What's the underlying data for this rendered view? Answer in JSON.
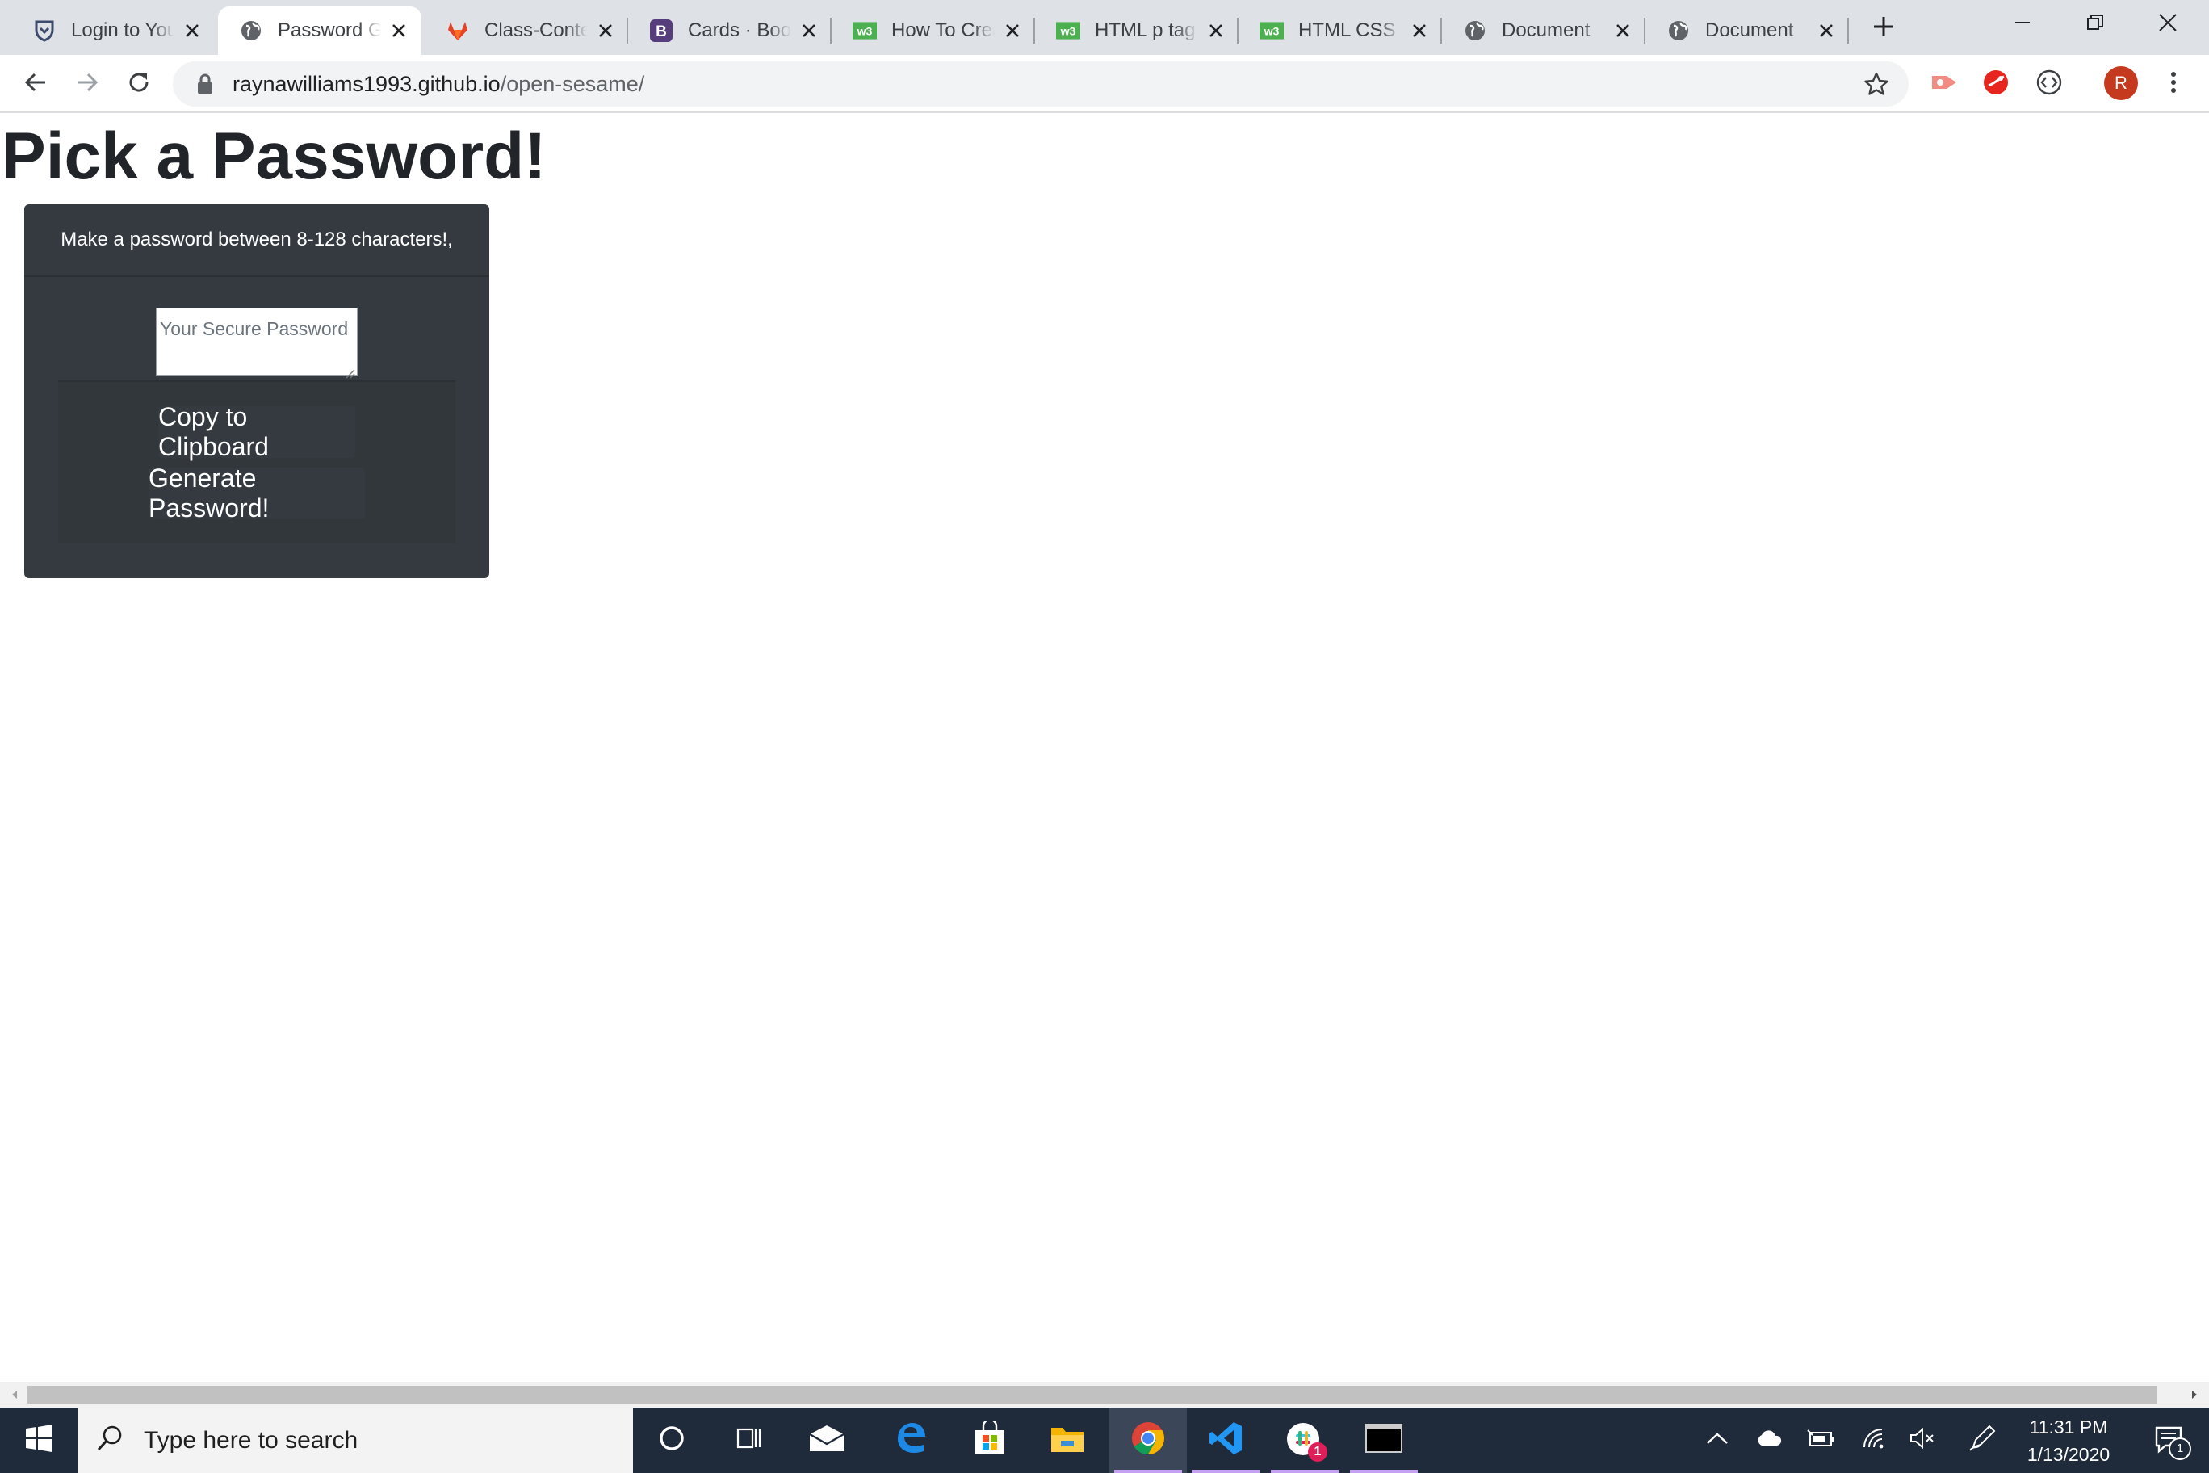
{
  "browser": {
    "tabs": [
      {
        "title": "Login to Your",
        "icon": "shield-icon",
        "active": false
      },
      {
        "title": "Password Generator",
        "icon": "globe-icon",
        "active": true
      },
      {
        "title": "Class-Content",
        "icon": "gitlab-icon",
        "active": false
      },
      {
        "title": "Cards · Bootstrap",
        "icon": "bootstrap-icon",
        "active": false
      },
      {
        "title": "How To Create",
        "icon": "w3schools-icon",
        "active": false
      },
      {
        "title": "HTML p tag",
        "icon": "w3schools-icon",
        "active": false
      },
      {
        "title": "HTML CSS",
        "icon": "w3schools-icon",
        "active": false
      },
      {
        "title": "Document",
        "icon": "globe-icon",
        "active": false
      },
      {
        "title": "Document",
        "icon": "globe-icon",
        "active": false
      }
    ],
    "address": {
      "host": "raynawilliams1993.github.io",
      "path": "/open-sesame/"
    },
    "profile_initial": "R"
  },
  "page": {
    "title": "Pick a Password!",
    "card": {
      "header": "Make a password between 8-128 characters!,",
      "password_placeholder": "Your Secure Password",
      "copy_button": "Copy to Clipboard",
      "generate_button": "Generate Password!"
    }
  },
  "taskbar": {
    "search_placeholder": "Type here to search",
    "slack_badge": "1",
    "time": "11:31 PM",
    "date": "1/13/2020",
    "notification_count": "1"
  },
  "colors": {
    "card_bg": "#343a40",
    "taskbar_bg": "#1f2a3a",
    "avatar": "#c5391f"
  }
}
